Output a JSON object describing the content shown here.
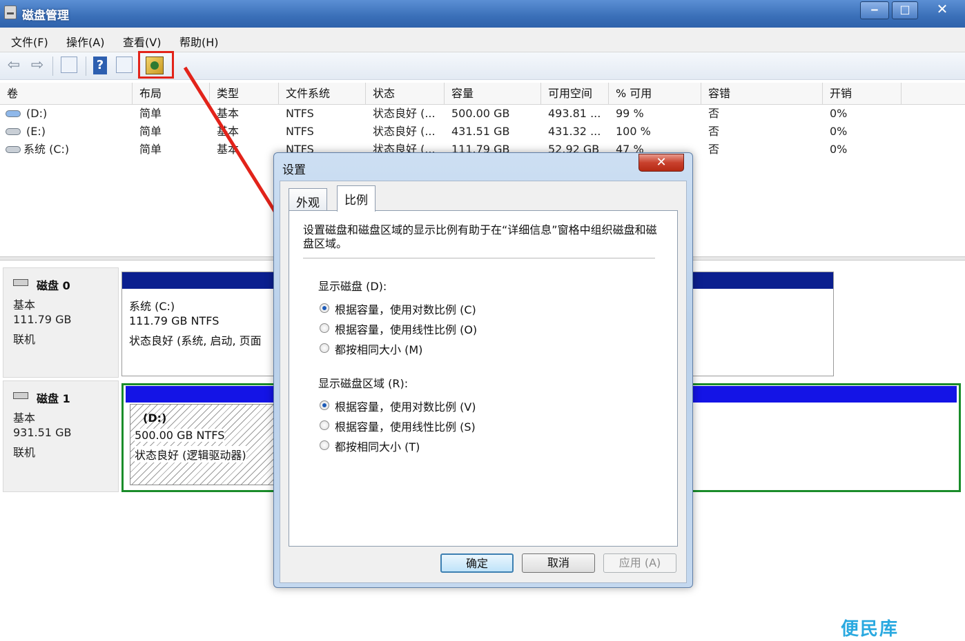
{
  "window": {
    "title": "磁盘管理",
    "min_label": "‒",
    "max_label": "□",
    "close_label": "✕"
  },
  "menu": [
    "文件(F)",
    "操作(A)",
    "查看(V)",
    "帮助(H)"
  ],
  "toolbar": {
    "back_label": "⇦",
    "forward_label": "⇨",
    "help_label": "?"
  },
  "volume_list": {
    "columns": [
      "卷",
      "布局",
      "类型",
      "文件系统",
      "状态",
      "容量",
      "可用空间",
      "% 可用",
      "容错",
      "开销"
    ],
    "rows": [
      {
        "volume": "(D:)",
        "layout": "简单",
        "type": "基本",
        "fs": "NTFS",
        "status": "状态良好 (...",
        "capacity": "500.00 GB",
        "free": "493.81 ...",
        "pct": "99 %",
        "fault": "否",
        "overhead": "0%"
      },
      {
        "volume": "(E:)",
        "layout": "简单",
        "type": "基本",
        "fs": "NTFS",
        "status": "状态良好 (...",
        "capacity": "431.51 GB",
        "free": "431.32 ...",
        "pct": "100 %",
        "fault": "否",
        "overhead": "0%"
      },
      {
        "volume": "系统 (C:)",
        "layout": "简单",
        "type": "基本",
        "fs": "NTFS",
        "status": "状态良好 (...",
        "capacity": "111.79 GB",
        "free": "52.92 GB",
        "pct": "47 %",
        "fault": "否",
        "overhead": "0%"
      }
    ]
  },
  "disks": [
    {
      "name": "磁盘 0",
      "kind": "基本",
      "size": "111.79 GB",
      "state": "联机",
      "partition": {
        "name": "系统 (C:)",
        "size_fs": "111.79 GB NTFS",
        "status": "状态良好 (系统, 启动, 页面"
      }
    },
    {
      "name": "磁盘 1",
      "kind": "基本",
      "size": "931.51 GB",
      "state": "联机",
      "partition": {
        "name": "(D:)",
        "size_fs": "500.00 GB NTFS",
        "status": "状态良好 (逻辑驱动器)"
      }
    }
  ],
  "dialog": {
    "title": "设置",
    "close_label": "✕",
    "tabs": [
      "外观",
      "比例"
    ],
    "active_tab": "比例",
    "description": "设置磁盘和磁盘区域的显示比例有助于在“详细信息”窗格中组织磁盘和磁盘区域。",
    "disk_group": {
      "label": "显示磁盘 (D):",
      "options": [
        "根据容量，使用对数比例 (C)",
        "根据容量，使用线性比例 (O)",
        "都按相同大小 (M)"
      ],
      "selected": 0
    },
    "region_group": {
      "label": "显示磁盘区域 (R):",
      "options": [
        "根据容量，使用对数比例 (V)",
        "根据容量，使用线性比例 (S)",
        "都按相同大小 (T)"
      ],
      "selected": 0
    },
    "buttons": {
      "ok": "确定",
      "cancel": "取消",
      "apply": "应用 (A)"
    }
  },
  "watermark": "便民库",
  "colors": {
    "highlight_red": "#e2231a",
    "selection_green": "#1a8c2a",
    "partition_bar_dark": "#0b1f8f",
    "partition_bar_bright": "#1414e6"
  }
}
